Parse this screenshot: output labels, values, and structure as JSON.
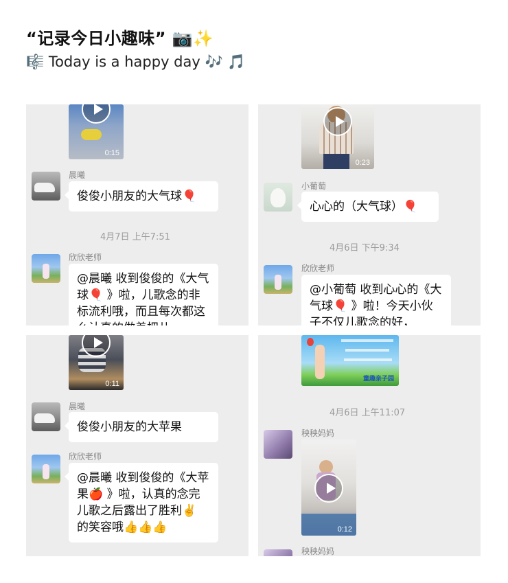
{
  "header": {
    "title": "“记录今日小趣味” 📷✨",
    "subtitle": "🎼 Today is a happy day 🎶 🎵"
  },
  "panel1": {
    "video_duration": "0:15",
    "msg1": {
      "sender": "晨曦",
      "text": "俊俊小朋友的大气球🎈"
    },
    "timestamp": "4月7日 上午7:51",
    "msg2": {
      "sender": "欣欣老师",
      "text": "@晨曦 收到俊俊的《大气球🎈 》啦，儿歌念的非标流利哦，而且每次都这么认真的做着把儿"
    }
  },
  "panel2": {
    "video_duration": "0:23",
    "msg1": {
      "sender": "小葡萄",
      "text": "心心的（大气球）🎈"
    },
    "timestamp": "4月6日 下午9:34",
    "msg2": {
      "sender": "欣欣老师",
      "text": "@小葡萄 收到心心的《大气球🎈 》啦！今天小伙子不仅儿歌念的好，"
    }
  },
  "panel3": {
    "video_duration": "0:11",
    "msg1": {
      "sender": "晨曦",
      "text": "俊俊小朋友的大苹果"
    },
    "msg2": {
      "sender": "欣欣老师",
      "text": "@晨曦 收到俊俊的《大苹果🍎 》啦，认真的念完儿歌之后露出了胜利✌️ 的笑容哦👍👍👍"
    }
  },
  "panel4": {
    "image_caption": "童趣亲子园",
    "timestamp": "4月6日 上午11:07",
    "msg1": {
      "sender": "秧秧妈妈",
      "video_duration": "0:12"
    },
    "msg2": {
      "sender": "秧秧妈妈"
    }
  },
  "colors": {
    "panel_bg": "#ededed",
    "bubble_bg": "#ffffff",
    "meta_text": "#9b9b9b"
  }
}
